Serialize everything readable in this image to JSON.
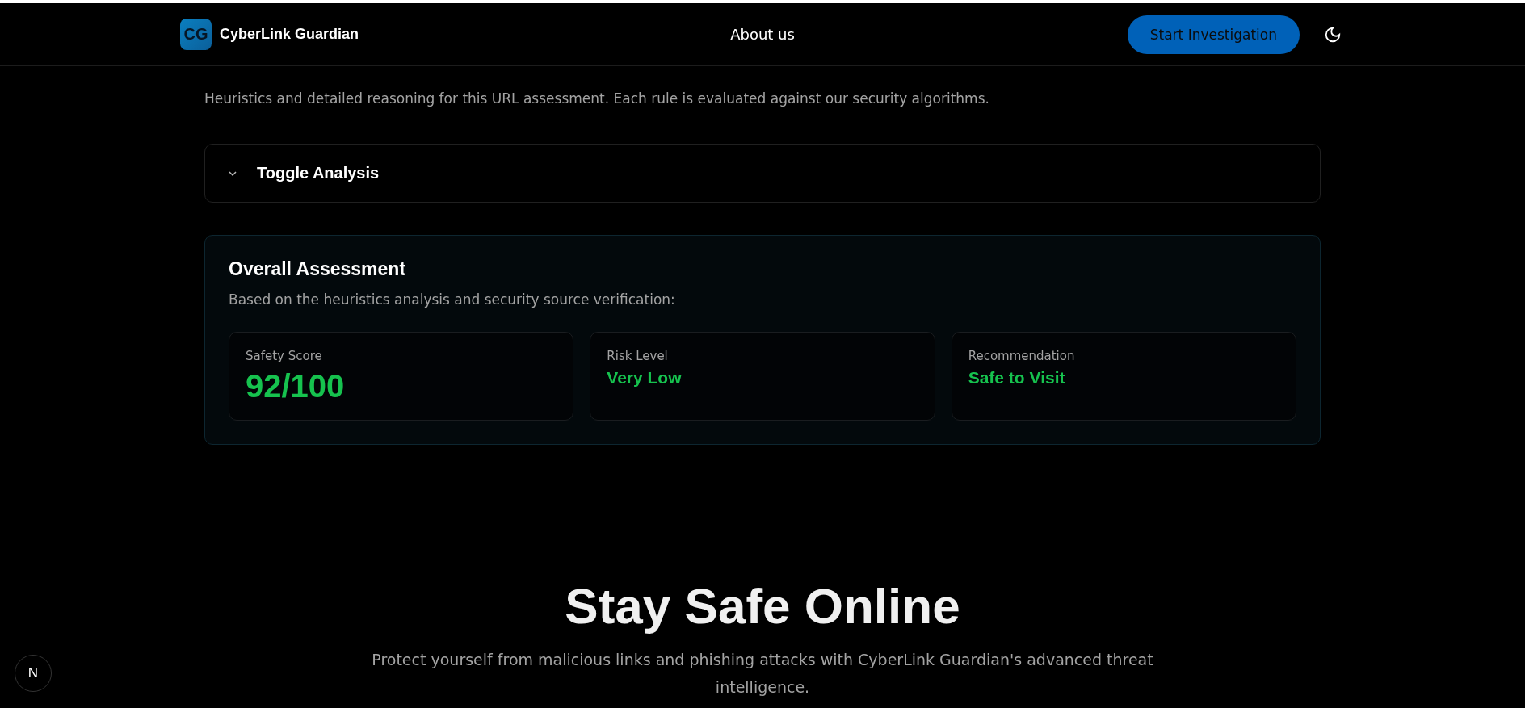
{
  "header": {
    "logo_mark": "CG",
    "brand": "CyberLink Guardian",
    "nav": [
      {
        "label": "About us"
      }
    ],
    "cta": "Start Investigation",
    "theme_toggle": {
      "dark": true
    }
  },
  "analysis": {
    "description": "Heuristics and detailed reasoning for this URL assessment. Each rule is evaluated against our security algorithms.",
    "toggle": {
      "label": "Toggle Analysis",
      "expanded": false
    }
  },
  "assessment": {
    "title": "Overall Assessment",
    "description": "Based on the heuristics analysis and security source verification:",
    "stats": [
      {
        "label": "Safety Score",
        "value": "92/100",
        "kind": "score",
        "color": "#16c24e"
      },
      {
        "label": "Risk Level",
        "value": "Very Low",
        "kind": "text",
        "color": "#16c24e"
      },
      {
        "label": "Recommendation",
        "value": "Safe to Visit",
        "kind": "text",
        "color": "#16c24e"
      }
    ]
  },
  "hero": {
    "title": "Stay Safe Online",
    "text": "Protect yourself from malicious links and phishing attacks with CyberLink Guardian's advanced threat intelligence."
  },
  "dev_badge": {
    "letter": "N"
  }
}
